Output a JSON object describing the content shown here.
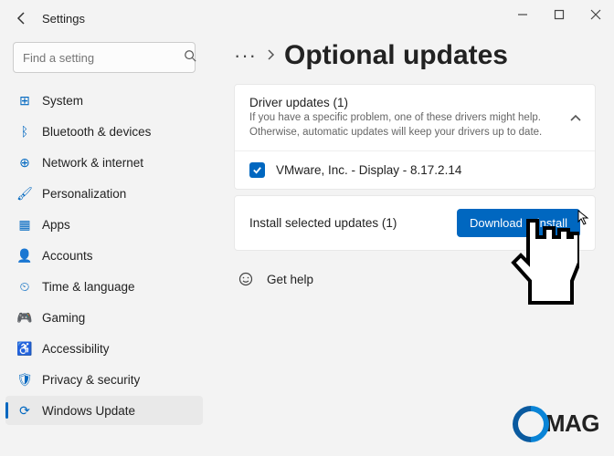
{
  "window": {
    "title": "Settings"
  },
  "search": {
    "placeholder": "Find a setting"
  },
  "sidebar": {
    "items": [
      {
        "label": "System",
        "icon": "⊞"
      },
      {
        "label": "Bluetooth & devices",
        "icon": "ᛒ"
      },
      {
        "label": "Network & internet",
        "icon": "⊕"
      },
      {
        "label": "Personalization",
        "icon": "🖌"
      },
      {
        "label": "Apps",
        "icon": "▦"
      },
      {
        "label": "Accounts",
        "icon": "👤"
      },
      {
        "label": "Time & language",
        "icon": "⏲"
      },
      {
        "label": "Gaming",
        "icon": "🎮"
      },
      {
        "label": "Accessibility",
        "icon": "♿"
      },
      {
        "label": "Privacy & security",
        "icon": "🛡"
      },
      {
        "label": "Windows Update",
        "icon": "⟳"
      }
    ],
    "selected_index": 10
  },
  "breadcrumb": {
    "ellipsis": "···",
    "page_title": "Optional updates"
  },
  "driver_updates": {
    "title": "Driver updates (1)",
    "subtitle": "If you have a specific problem, one of these drivers might help. Otherwise, automatic updates will keep your drivers up to date.",
    "items": [
      {
        "label": "VMware, Inc. - Display - 8.17.2.14",
        "checked": true
      }
    ]
  },
  "install_bar": {
    "text": "Install selected updates (1)",
    "button": "Download & install"
  },
  "help": {
    "label": "Get help"
  },
  "logo": {
    "text": "MAG"
  }
}
